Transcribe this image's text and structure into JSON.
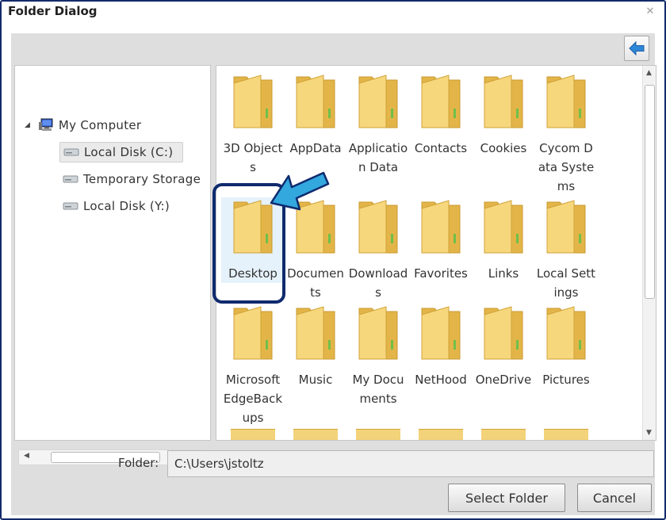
{
  "window": {
    "title": "Folder Dialog",
    "close_glyph": "✕"
  },
  "toolbar": {
    "back_icon": "back-arrow-icon"
  },
  "tree": {
    "expander": "◢",
    "root_label": "My Computer",
    "items": [
      {
        "label": "Local Disk (C:)",
        "selected": true
      },
      {
        "label": "Temporary Storage"
      },
      {
        "label": "Local Disk (Y:)"
      }
    ]
  },
  "folders": [
    {
      "name": "3D Objects"
    },
    {
      "name": "AppData"
    },
    {
      "name": "Application Data"
    },
    {
      "name": "Contacts"
    },
    {
      "name": "Cookies"
    },
    {
      "name": "Cycom Data Systems"
    },
    {
      "name": "Desktop",
      "selected": true
    },
    {
      "name": "Documents"
    },
    {
      "name": "Downloads"
    },
    {
      "name": "Favorites"
    },
    {
      "name": "Links"
    },
    {
      "name": "Local Settings"
    },
    {
      "name": "MicrosoftEdgeBackups"
    },
    {
      "name": "Music"
    },
    {
      "name": "My Documents"
    },
    {
      "name": "NetHood"
    },
    {
      "name": "OneDrive"
    },
    {
      "name": "Pictures"
    }
  ],
  "folder_field": {
    "label": "Folder:",
    "value": "C:\\Users\\jstoltz"
  },
  "buttons": {
    "select_folder": "Select Folder",
    "cancel": "Cancel"
  },
  "colors": {
    "accent": "#13296b",
    "arrow": "#32a8de",
    "folder": "#f2cc6a"
  }
}
